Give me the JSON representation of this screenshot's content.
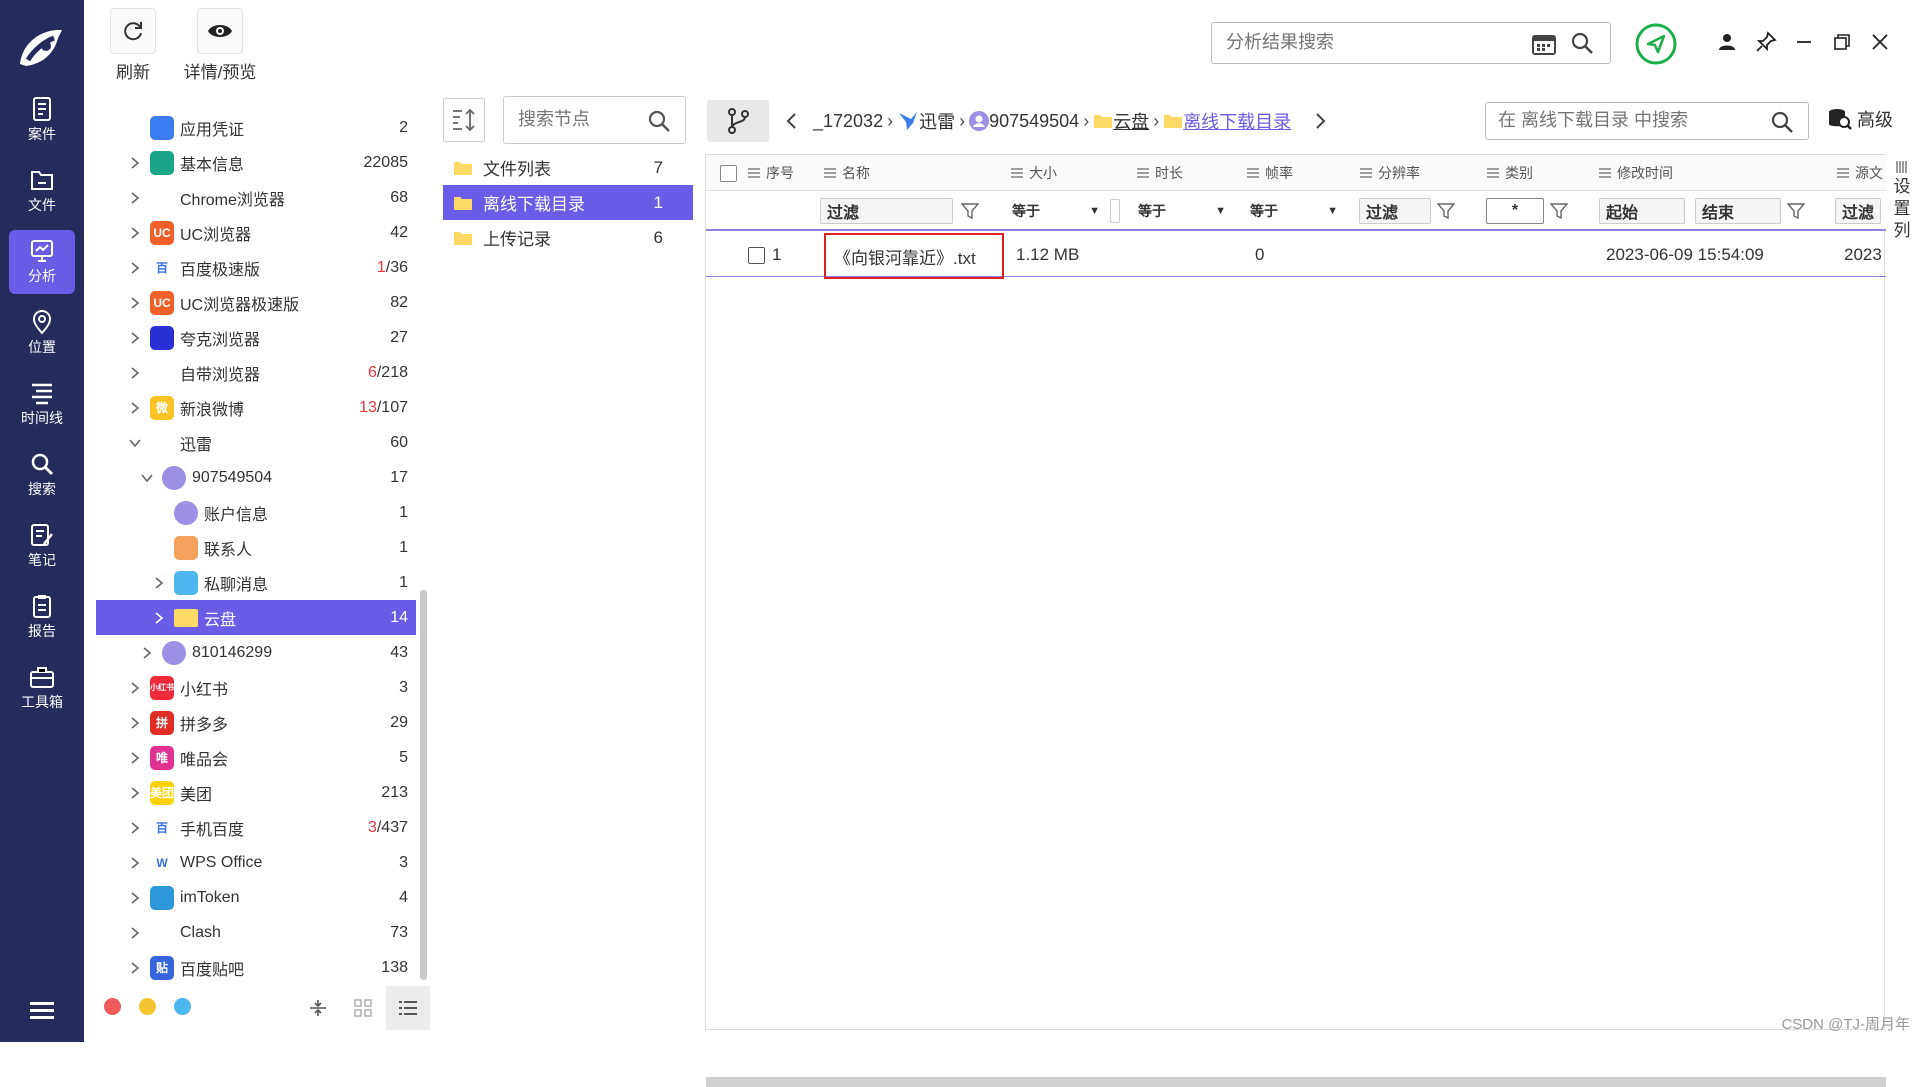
{
  "nav": {
    "items": [
      {
        "id": "case",
        "label": "案件",
        "active": false
      },
      {
        "id": "file",
        "label": "文件",
        "active": false
      },
      {
        "id": "analysis",
        "label": "分析",
        "active": true
      },
      {
        "id": "location",
        "label": "位置",
        "active": false
      },
      {
        "id": "timeline",
        "label": "时间线",
        "active": false
      },
      {
        "id": "search",
        "label": "搜索",
        "active": false
      },
      {
        "id": "notes",
        "label": "笔记",
        "active": false
      },
      {
        "id": "report",
        "label": "报告",
        "active": false
      },
      {
        "id": "toolbox",
        "label": "工具箱",
        "active": false
      }
    ]
  },
  "toolbar": {
    "refresh_label": "刷新",
    "preview_label": "详情/预览",
    "search_placeholder": "分析结果搜索"
  },
  "tree": {
    "items": [
      {
        "label": "应用凭证",
        "count": "2",
        "count_red": "",
        "icon": "credential",
        "bg": "#3d7df2",
        "text": ""
      },
      {
        "label": "基本信息",
        "count": "22085",
        "count_red": "",
        "icon": "info",
        "bg": "#1aa589",
        "text": ""
      },
      {
        "label": "Chrome浏览器",
        "count": "68",
        "count_red": "",
        "icon": "chrome",
        "bg": "#ffffff",
        "text": ""
      },
      {
        "label": "UC浏览器",
        "count": "42",
        "count_red": "",
        "icon": "uc",
        "bg": "#f0602a",
        "text": "UC"
      },
      {
        "label": "百度极速版",
        "count": "/36",
        "count_red": "1",
        "icon": "baidu",
        "bg": "#ffffff",
        "text": "百"
      },
      {
        "label": "UC浏览器极速版",
        "count": "82",
        "count_red": "",
        "icon": "uc-fast",
        "bg": "#f0602a",
        "text": "UC"
      },
      {
        "label": "夸克浏览器",
        "count": "27",
        "count_red": "",
        "icon": "quark",
        "bg": "#2b2fd6",
        "text": ""
      },
      {
        "label": "自带浏览器",
        "count": "/218",
        "count_red": "6",
        "icon": "browser",
        "bg": "#ffffff",
        "text": ""
      },
      {
        "label": "新浪微博",
        "count": "/107",
        "count_red": "13",
        "icon": "weibo",
        "bg": "#f9c423",
        "text": "微"
      },
      {
        "label": "迅雷",
        "count": "60",
        "count_red": "",
        "icon": "xunlei",
        "bg": "#ffffff",
        "text": ""
      },
      {
        "label": "907549504",
        "count": "17",
        "count_red": "",
        "icon": "user",
        "bg": "#9b8fe6",
        "text": ""
      },
      {
        "label": "账户信息",
        "count": "1",
        "count_red": "",
        "icon": "account",
        "bg": "#9b8fe6",
        "text": ""
      },
      {
        "label": "联系人",
        "count": "1",
        "count_red": "",
        "icon": "contact",
        "bg": "#f4a15d",
        "text": ""
      },
      {
        "label": "私聊消息",
        "count": "1",
        "count_red": "",
        "icon": "chat",
        "bg": "#4fb6f0",
        "text": ""
      },
      {
        "label": "云盘",
        "count": "14",
        "count_red": "",
        "icon": "folder",
        "bg": "#ffd966",
        "text": ""
      },
      {
        "label": "810146299",
        "count": "43",
        "count_red": "",
        "icon": "user",
        "bg": "#9b8fe6",
        "text": ""
      },
      {
        "label": "小红书",
        "count": "3",
        "count_red": "",
        "icon": "xiaohongshu",
        "bg": "#ee2a3a",
        "text": "小红书"
      },
      {
        "label": "拼多多",
        "count": "29",
        "count_red": "",
        "icon": "pinduoduo",
        "bg": "#e02e24",
        "text": "拼"
      },
      {
        "label": "唯品会",
        "count": "5",
        "count_red": "",
        "icon": "vip",
        "bg": "#e2328f",
        "text": "唯"
      },
      {
        "label": "美团",
        "count": "213",
        "count_red": "",
        "icon": "meituan",
        "bg": "#ffd100",
        "text": "美团"
      },
      {
        "label": "手机百度",
        "count": "/437",
        "count_red": "3",
        "icon": "baidu-mobile",
        "bg": "#ffffff",
        "text": "百"
      },
      {
        "label": "WPS Office",
        "count": "3",
        "count_red": "",
        "icon": "wps",
        "bg": "#ffffff",
        "text": "W"
      },
      {
        "label": "imToken",
        "count": "4",
        "count_red": "",
        "icon": "imtoken",
        "bg": "#2d97d9",
        "text": ""
      },
      {
        "label": "Clash",
        "count": "73",
        "count_red": "",
        "icon": "clash",
        "bg": "#ffffff",
        "text": ""
      },
      {
        "label": "百度贴吧",
        "count": "138",
        "count_red": "",
        "icon": "tieba",
        "bg": "#3366dd",
        "text": "贴"
      }
    ]
  },
  "mid": {
    "search_placeholder": "搜索节点",
    "items": [
      {
        "label": "文件列表",
        "count": "7"
      },
      {
        "label": "离线下载目录",
        "count": "1"
      },
      {
        "label": "上传记录",
        "count": "6"
      }
    ]
  },
  "breadcrumb": {
    "parts": [
      "_172032",
      "迅雷",
      "907549504",
      "云盘",
      "离线下载目录"
    ],
    "search_placeholder": "在 离线下载目录 中搜索",
    "advanced_label": "高级"
  },
  "grid": {
    "headers": [
      "序号",
      "名称",
      "大小",
      "时长",
      "帧率",
      "分辨率",
      "类别",
      "修改时间",
      "源文"
    ],
    "filters": {
      "name": "过滤",
      "size_op": "等于",
      "duration_op": "等于",
      "fps_op": "等于",
      "resolution": "过滤",
      "category": "*",
      "time_start": "起始",
      "time_end": "结束",
      "source": "过滤"
    },
    "rows": [
      {
        "index": "1",
        "name": "《向银河靠近》.txt",
        "size": "1.12 MB",
        "duration": "",
        "fps": "0",
        "resolution": "",
        "category": "",
        "mtime": "2023-06-09 15:54:09",
        "source": "2023"
      }
    ],
    "column_settings": "设置列"
  },
  "watermark": "CSDN @TJ-周月年",
  "colors": {
    "sidebar": "#252b5c",
    "accent": "#6b5ce7",
    "highlight_border": "#e02020",
    "red_count": "#e5383b"
  }
}
